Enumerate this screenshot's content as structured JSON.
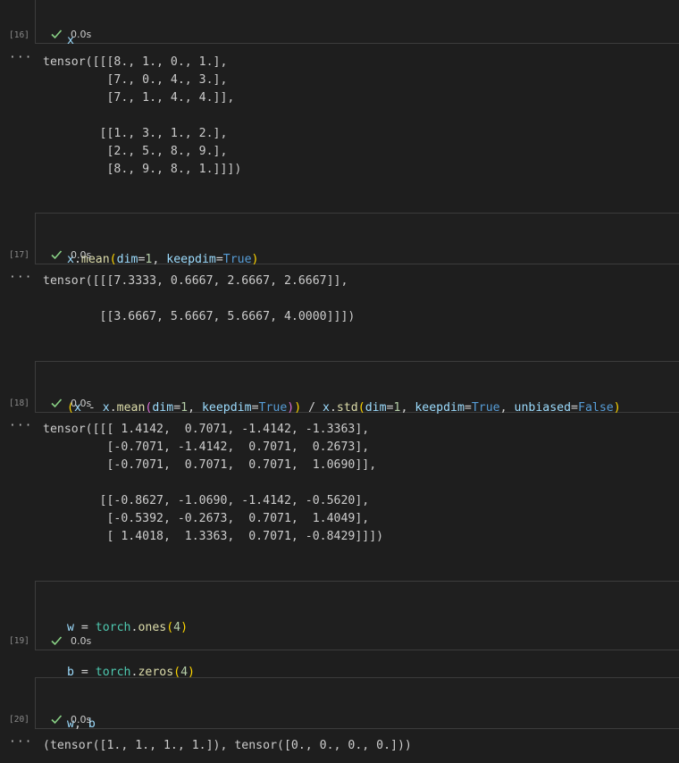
{
  "cells": [
    {
      "count": "[16]",
      "status": "0.0s",
      "code_tokens": [
        [
          {
            "t": "x",
            "c": "t-var"
          }
        ]
      ],
      "output": [
        "tensor([[[8., 1., 0., 1.],",
        "         [7., 0., 4., 3.],",
        "         [7., 1., 4., 4.]],",
        "",
        "        [[1., 3., 1., 2.],",
        "         [2., 5., 8., 9.],",
        "         [8., 9., 8., 1.]]])"
      ]
    },
    {
      "count": "[17]",
      "status": "0.0s",
      "code_tokens": [
        [
          {
            "t": "x",
            "c": "t-var"
          },
          {
            "t": ".",
            "c": "t-op"
          },
          {
            "t": "mean",
            "c": "t-fn"
          },
          {
            "t": "(",
            "c": "t-p1"
          },
          {
            "t": "dim",
            "c": "t-var"
          },
          {
            "t": "=",
            "c": "t-op"
          },
          {
            "t": "1",
            "c": "t-num"
          },
          {
            "t": ", ",
            "c": "t-op"
          },
          {
            "t": "keepdim",
            "c": "t-var"
          },
          {
            "t": "=",
            "c": "t-op"
          },
          {
            "t": "True",
            "c": "t-kw"
          },
          {
            "t": ")",
            "c": "t-p1"
          }
        ]
      ],
      "output": [
        "tensor([[[7.3333, 0.6667, 2.6667, 2.6667]],",
        "",
        "        [[3.6667, 5.6667, 5.6667, 4.0000]]])"
      ]
    },
    {
      "count": "[18]",
      "status": "0.0s",
      "code_tokens": [
        [
          {
            "t": "(",
            "c": "t-p1"
          },
          {
            "t": "x",
            "c": "t-var"
          },
          {
            "t": " - ",
            "c": "t-op"
          },
          {
            "t": "x",
            "c": "t-var"
          },
          {
            "t": ".",
            "c": "t-op"
          },
          {
            "t": "mean",
            "c": "t-fn"
          },
          {
            "t": "(",
            "c": "t-p2"
          },
          {
            "t": "dim",
            "c": "t-var"
          },
          {
            "t": "=",
            "c": "t-op"
          },
          {
            "t": "1",
            "c": "t-num"
          },
          {
            "t": ", ",
            "c": "t-op"
          },
          {
            "t": "keepdim",
            "c": "t-var"
          },
          {
            "t": "=",
            "c": "t-op"
          },
          {
            "t": "True",
            "c": "t-kw"
          },
          {
            "t": ")",
            "c": "t-p2"
          },
          {
            "t": ")",
            "c": "t-p1"
          },
          {
            "t": " / ",
            "c": "t-op"
          },
          {
            "t": "x",
            "c": "t-var"
          },
          {
            "t": ".",
            "c": "t-op"
          },
          {
            "t": "std",
            "c": "t-fn"
          },
          {
            "t": "(",
            "c": "t-p1"
          },
          {
            "t": "dim",
            "c": "t-var"
          },
          {
            "t": "=",
            "c": "t-op"
          },
          {
            "t": "1",
            "c": "t-num"
          },
          {
            "t": ", ",
            "c": "t-op"
          },
          {
            "t": "keepdim",
            "c": "t-var"
          },
          {
            "t": "=",
            "c": "t-op"
          },
          {
            "t": "True",
            "c": "t-kw"
          },
          {
            "t": ", ",
            "c": "t-op"
          },
          {
            "t": "unbiased",
            "c": "t-var"
          },
          {
            "t": "=",
            "c": "t-op"
          },
          {
            "t": "False",
            "c": "t-kw"
          },
          {
            "t": ")",
            "c": "t-p1"
          }
        ]
      ],
      "output": [
        "tensor([[[ 1.4142,  0.7071, -1.4142, -1.3363],",
        "         [-0.7071, -1.4142,  0.7071,  0.2673],",
        "         [-0.7071,  0.7071,  0.7071,  1.0690]],",
        "",
        "        [[-0.8627, -1.0690, -1.4142, -0.5620],",
        "         [-0.5392, -0.2673,  0.7071,  1.4049],",
        "         [ 1.4018,  1.3363,  0.7071, -0.8429]]])"
      ]
    },
    {
      "count": "[19]",
      "status": "0.0s",
      "code_tokens": [
        [
          {
            "t": "w",
            "c": "t-var"
          },
          {
            "t": " = ",
            "c": "t-op"
          },
          {
            "t": "torch",
            "c": "t-cls"
          },
          {
            "t": ".",
            "c": "t-op"
          },
          {
            "t": "ones",
            "c": "t-fn"
          },
          {
            "t": "(",
            "c": "t-p1"
          },
          {
            "t": "4",
            "c": "t-num"
          },
          {
            "t": ")",
            "c": "t-p1"
          }
        ],
        [
          {
            "t": "b",
            "c": "t-var"
          },
          {
            "t": " = ",
            "c": "t-op"
          },
          {
            "t": "torch",
            "c": "t-cls"
          },
          {
            "t": ".",
            "c": "t-op"
          },
          {
            "t": "zeros",
            "c": "t-fn"
          },
          {
            "t": "(",
            "c": "t-p1"
          },
          {
            "t": "4",
            "c": "t-num"
          },
          {
            "t": ")",
            "c": "t-p1"
          }
        ]
      ],
      "output": []
    },
    {
      "count": "[20]",
      "status": "0.0s",
      "code_tokens": [
        [
          {
            "t": "w",
            "c": "t-var"
          },
          {
            "t": ", ",
            "c": "t-op"
          },
          {
            "t": "b",
            "c": "t-var"
          }
        ]
      ],
      "output": [
        "(tensor([1., 1., 1., 1.]), tensor([0., 0., 0., 0.]))"
      ]
    }
  ],
  "colors": {
    "background": "#1e1e1e",
    "cell_background": "#1f1f1f",
    "border": "#3c3c3c",
    "check": "#89d185"
  },
  "icons": {
    "status": "check-icon",
    "output_menu": "ellipsis-icon"
  },
  "output_icon_glyph": "···"
}
